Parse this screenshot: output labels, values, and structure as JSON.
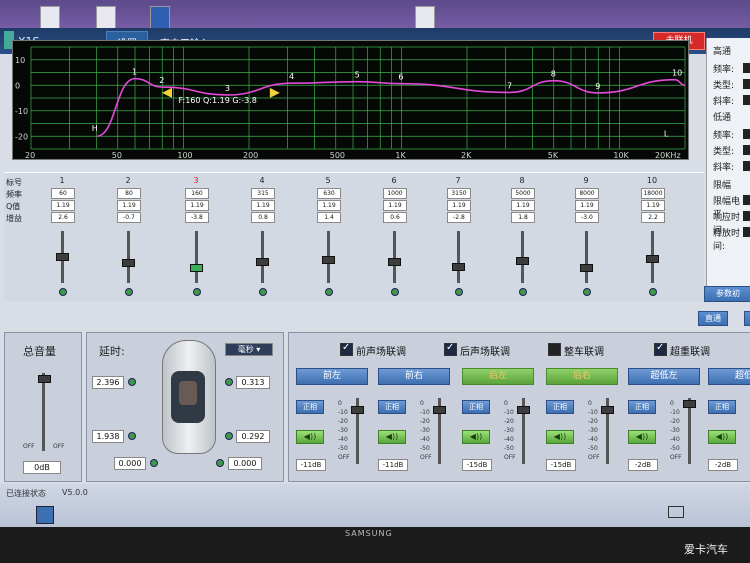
{
  "window": {
    "app_title": "X1S",
    "menu_settings": "设置",
    "menu_input": "高电平输入▾",
    "status": "未联机"
  },
  "graph": {
    "y_labels": [
      "10",
      "0",
      "-10",
      "-20"
    ],
    "x_labels": [
      "20",
      "50",
      "100",
      "200",
      "500",
      "1K",
      "2K",
      "5K",
      "10K",
      "20KHz"
    ],
    "point_labels": [
      "1",
      "2",
      "3",
      "4",
      "5",
      "6",
      "7",
      "8",
      "9",
      "10"
    ],
    "marker_h": "H",
    "marker_l": "L",
    "info": "F:160 Q:1.19 G:-3.8"
  },
  "right_panel": {
    "labels": [
      "高通",
      "频率:",
      "类型:",
      "斜率:",
      "低通",
      "频率:",
      "类型:",
      "斜率:",
      "限幅",
      "限幅电平:",
      "响应时间:",
      "释放时间:"
    ],
    "btn_reset": "参数初",
    "btn_direct": "直通"
  },
  "bands": {
    "row_labels": [
      "标号",
      "频率",
      "Q值",
      "增益"
    ],
    "numbers": [
      "1",
      "2",
      "3",
      "4",
      "5",
      "6",
      "7",
      "8",
      "9",
      "10"
    ],
    "freq": [
      "60",
      "80",
      "160",
      "315",
      "630",
      "1000",
      "3150",
      "5000",
      "8000",
      "18000"
    ],
    "q": [
      "1.19",
      "1.19",
      "1.19",
      "1.19",
      "1.19",
      "1.19",
      "1.19",
      "1.19",
      "1.19",
      "1.19"
    ],
    "gain": [
      "2.6",
      "-0.7",
      "-3.8",
      "0.8",
      "1.4",
      "0.6",
      "-2.8",
      "1.8",
      "-3.0",
      "2.2"
    ],
    "selected": 2
  },
  "master": {
    "title": "总音量",
    "off_left": "OFF",
    "off_right": "OFF",
    "value": "0dB"
  },
  "delay": {
    "title": "延时:",
    "unit": "毫秒 ▾",
    "values": [
      "2.396",
      "0.313",
      "1.938",
      "0.292",
      "0.000",
      "0.000"
    ]
  },
  "channels": {
    "links": [
      "前声场联调",
      "后声场联调",
      "整车联调",
      "超重联调"
    ],
    "link_states": [
      true,
      true,
      false,
      true
    ],
    "names": [
      "前左",
      "前右",
      "后左",
      "后右",
      "超低左",
      "超低"
    ],
    "phase": "正相",
    "mute_icon": "◀))",
    "db": [
      "-11dB",
      "-11dB",
      "-15dB",
      "-15dB",
      "-2dB",
      "-2dB"
    ],
    "scale": [
      "0",
      "-10",
      "-20",
      "-30",
      "-40",
      "-50",
      "OFF"
    ]
  },
  "taskbar": {
    "left_text": "已连接状态",
    "version": "V5.0.0"
  },
  "bezel": {
    "brand": "SAMSUNG",
    "watermark": "爱卡汽车"
  },
  "colors": {
    "curve": "#e24ad8",
    "grid": "#39b04a",
    "arrow": "#f1d13a",
    "status_red": "#d42a2a"
  }
}
